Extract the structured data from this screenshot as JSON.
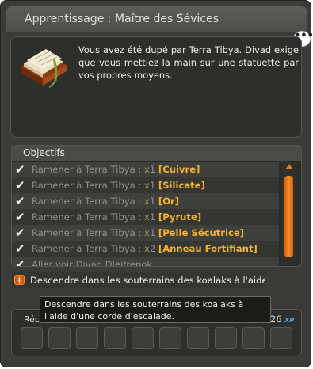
{
  "window": {
    "title": "Apprentissage : Maître des Sévices",
    "description": "Vous avez été dupé par Terra Tibya. Divad exige que vous mettiez la main sur une statuette par vos propres moyens.",
    "chat_icon": "speech-bubble-icon",
    "quest_icon": "book-icon"
  },
  "objectives": {
    "header": "Objectifs",
    "items": [
      {
        "prefix": "Ramener à Terra Tibya : x1 ",
        "item": "[Cuivre]",
        "done": true
      },
      {
        "prefix": "Ramener à Terra Tibya : x1 ",
        "item": "[Silicate]",
        "done": true
      },
      {
        "prefix": "Ramener à Terra Tibya : x1 ",
        "item": "[Or]",
        "done": true
      },
      {
        "prefix": "Ramener à Terra Tibya : x1 ",
        "item": "[Pyrute]",
        "done": true
      },
      {
        "prefix": "Ramener à Terra Tibya : x1 ",
        "item": "[Pelle Sécutrice]",
        "done": true
      },
      {
        "prefix": "Ramener à Terra Tibya : x2 ",
        "item": "[Anneau Fortifiant]",
        "done": true
      },
      {
        "prefix": "Aller voir Divad Dleifrepok",
        "item": "",
        "done": true
      },
      {
        "prefix": "Descendre dans les souterrains des koalaks à l'aide...",
        "item": "",
        "done": false
      }
    ]
  },
  "tooltip": {
    "text": "Descendre dans les souterrains des koalaks à l'aide d'une corde d'escalade."
  },
  "rewards": {
    "label": "Réco",
    "xp_value": "5 349 726",
    "xp_badge": "XP"
  },
  "colors": {
    "highlight": "#f3b32c",
    "accent_orange": "#e67a1a",
    "background": "#3b3b38"
  }
}
